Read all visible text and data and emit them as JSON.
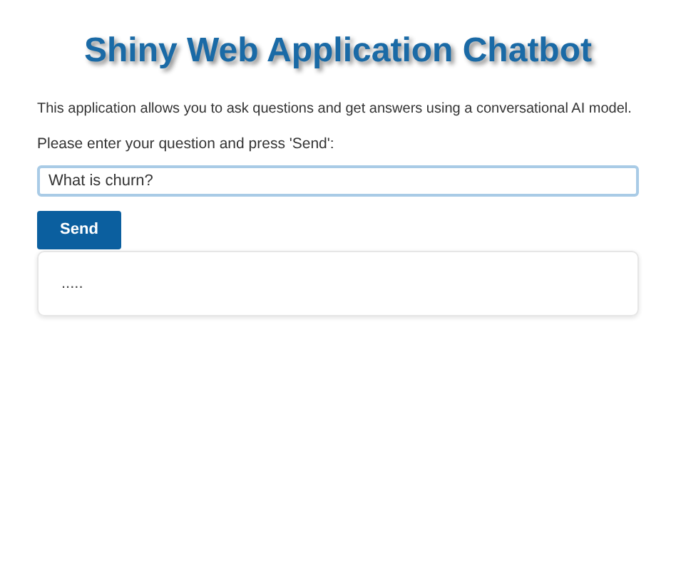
{
  "title": "Shiny Web Application Chatbot",
  "description": "This application allows you to ask questions and get answers using a conversational AI model.",
  "question_field": {
    "label": "Please enter your question and press 'Send':",
    "value": "What is churn?",
    "focused": true
  },
  "send_button": {
    "label": "Send"
  },
  "response": {
    "text": "....."
  }
}
